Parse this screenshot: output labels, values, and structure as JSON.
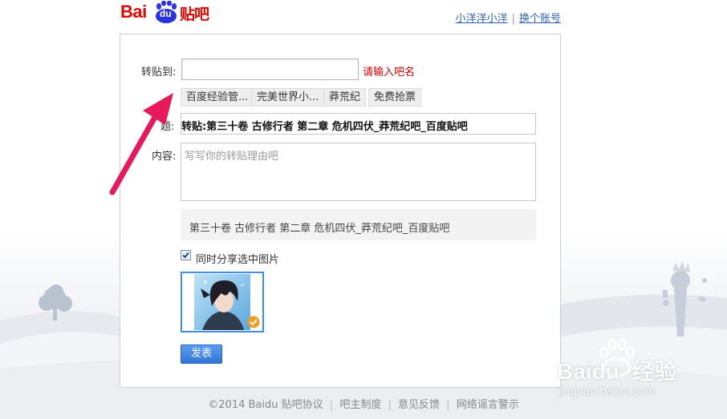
{
  "header": {
    "logo_bai": "Bai",
    "logo_du": "du",
    "logo_tieba": "贴吧",
    "user_name": "小洋洋小洋",
    "switch_account": "换个账号",
    "separator": "|"
  },
  "form": {
    "forum_label": "转贴到:",
    "forum_value": "",
    "forum_hint": "请输入吧名",
    "suggestions": [
      "百度经验管...",
      "完美世界小...",
      "莽荒纪",
      "免费抢票"
    ],
    "title_label": "题:",
    "title_value": "转贴:第三十卷 古修行者 第二章 危机四伏_莽荒纪吧_百度贴吧",
    "content_label": "内容:",
    "content_placeholder": "写写你的转贴理由吧",
    "preview_text": "第三十卷 古修行者 第二章 危机四伏_莽荒纪吧_百度贴吧",
    "share_images_label": "同时分享选中图片",
    "share_images_checked": true,
    "submit_label": "发表"
  },
  "footer": {
    "copyright": "©2014 Baidu",
    "links": [
      "贴吧协议",
      "吧主制度",
      "意见反馈",
      "网络谣言警示"
    ],
    "separator": "|"
  },
  "watermark": {
    "brand": "Bai",
    "brand_du": "du",
    "brand_cn": "经验",
    "url": "jingyan.baidu.com"
  },
  "colors": {
    "brand_red": "#e10601",
    "brand_blue": "#2d64b3",
    "hint_red": "#cc0000",
    "button_blue": "#3a80de",
    "arrow_pink": "#e8195a"
  }
}
